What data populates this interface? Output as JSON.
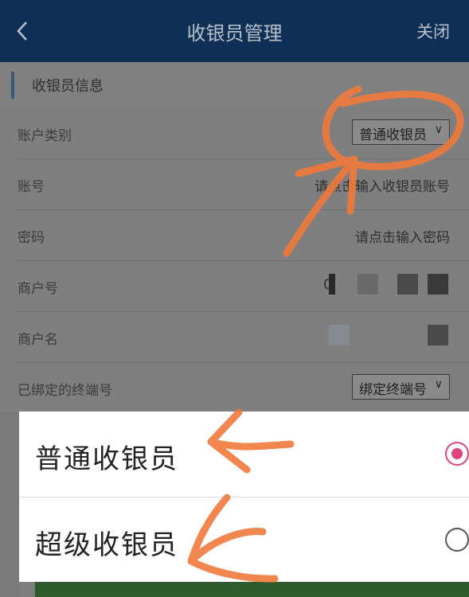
{
  "navbar": {
    "title": "收银员管理",
    "close_label": "关闭",
    "back_icon": "chevron-left-icon"
  },
  "section": {
    "title": "收银员信息"
  },
  "form": {
    "rows": [
      {
        "label": "账户类别",
        "value": "普通收银员",
        "kind": "select"
      },
      {
        "label": "账号",
        "value": "请点击输入收银员账号",
        "kind": "text"
      },
      {
        "label": "密码",
        "value": "请点击输入密码",
        "kind": "text"
      },
      {
        "label": "商户号",
        "value": "0",
        "kind": "masked"
      },
      {
        "label": "商户名",
        "value": "",
        "kind": "masked"
      },
      {
        "label": "已绑定的终端号",
        "value": "绑定终端号",
        "kind": "select"
      }
    ]
  },
  "sheet": {
    "options": [
      {
        "label": "普通收银员",
        "selected": true
      },
      {
        "label": "超级收银员",
        "selected": false
      }
    ]
  },
  "colors": {
    "navbar": "#0f2f55",
    "radio_selected": "#e0457b",
    "annotation": "#f07a3c"
  }
}
